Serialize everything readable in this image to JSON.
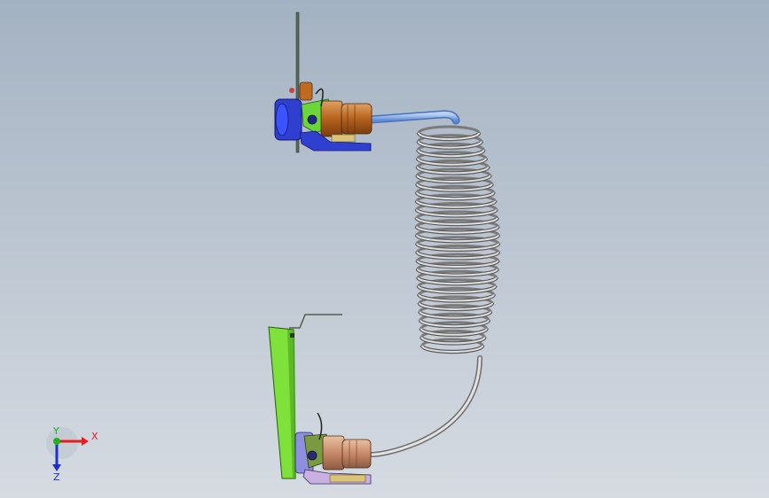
{
  "viewport": {
    "background_top": "#a3b2c2",
    "background_bottom": "#d6dbe2"
  },
  "model": {
    "parts": [
      {
        "name": "upper-socket-assembly",
        "colors": [
          "#2f3fd0",
          "#6ad63a",
          "#c06a20"
        ]
      },
      {
        "name": "coiled-cable",
        "colors": [
          "#8e8e8e",
          "#d8d8d8"
        ]
      },
      {
        "name": "straight-hose",
        "colors": [
          "#6f9fe6"
        ]
      },
      {
        "name": "lower-mounting-bracket",
        "colors": [
          "#7ee23a"
        ]
      },
      {
        "name": "lower-socket-assembly",
        "colors": [
          "#8f8fe0",
          "#c8896a",
          "#d9c27a"
        ]
      }
    ]
  },
  "triad": {
    "x_label": "X",
    "y_label": "Y",
    "z_label": "Z",
    "x_color": "#e02020",
    "y_color": "#20b020",
    "z_color": "#2030d0"
  }
}
